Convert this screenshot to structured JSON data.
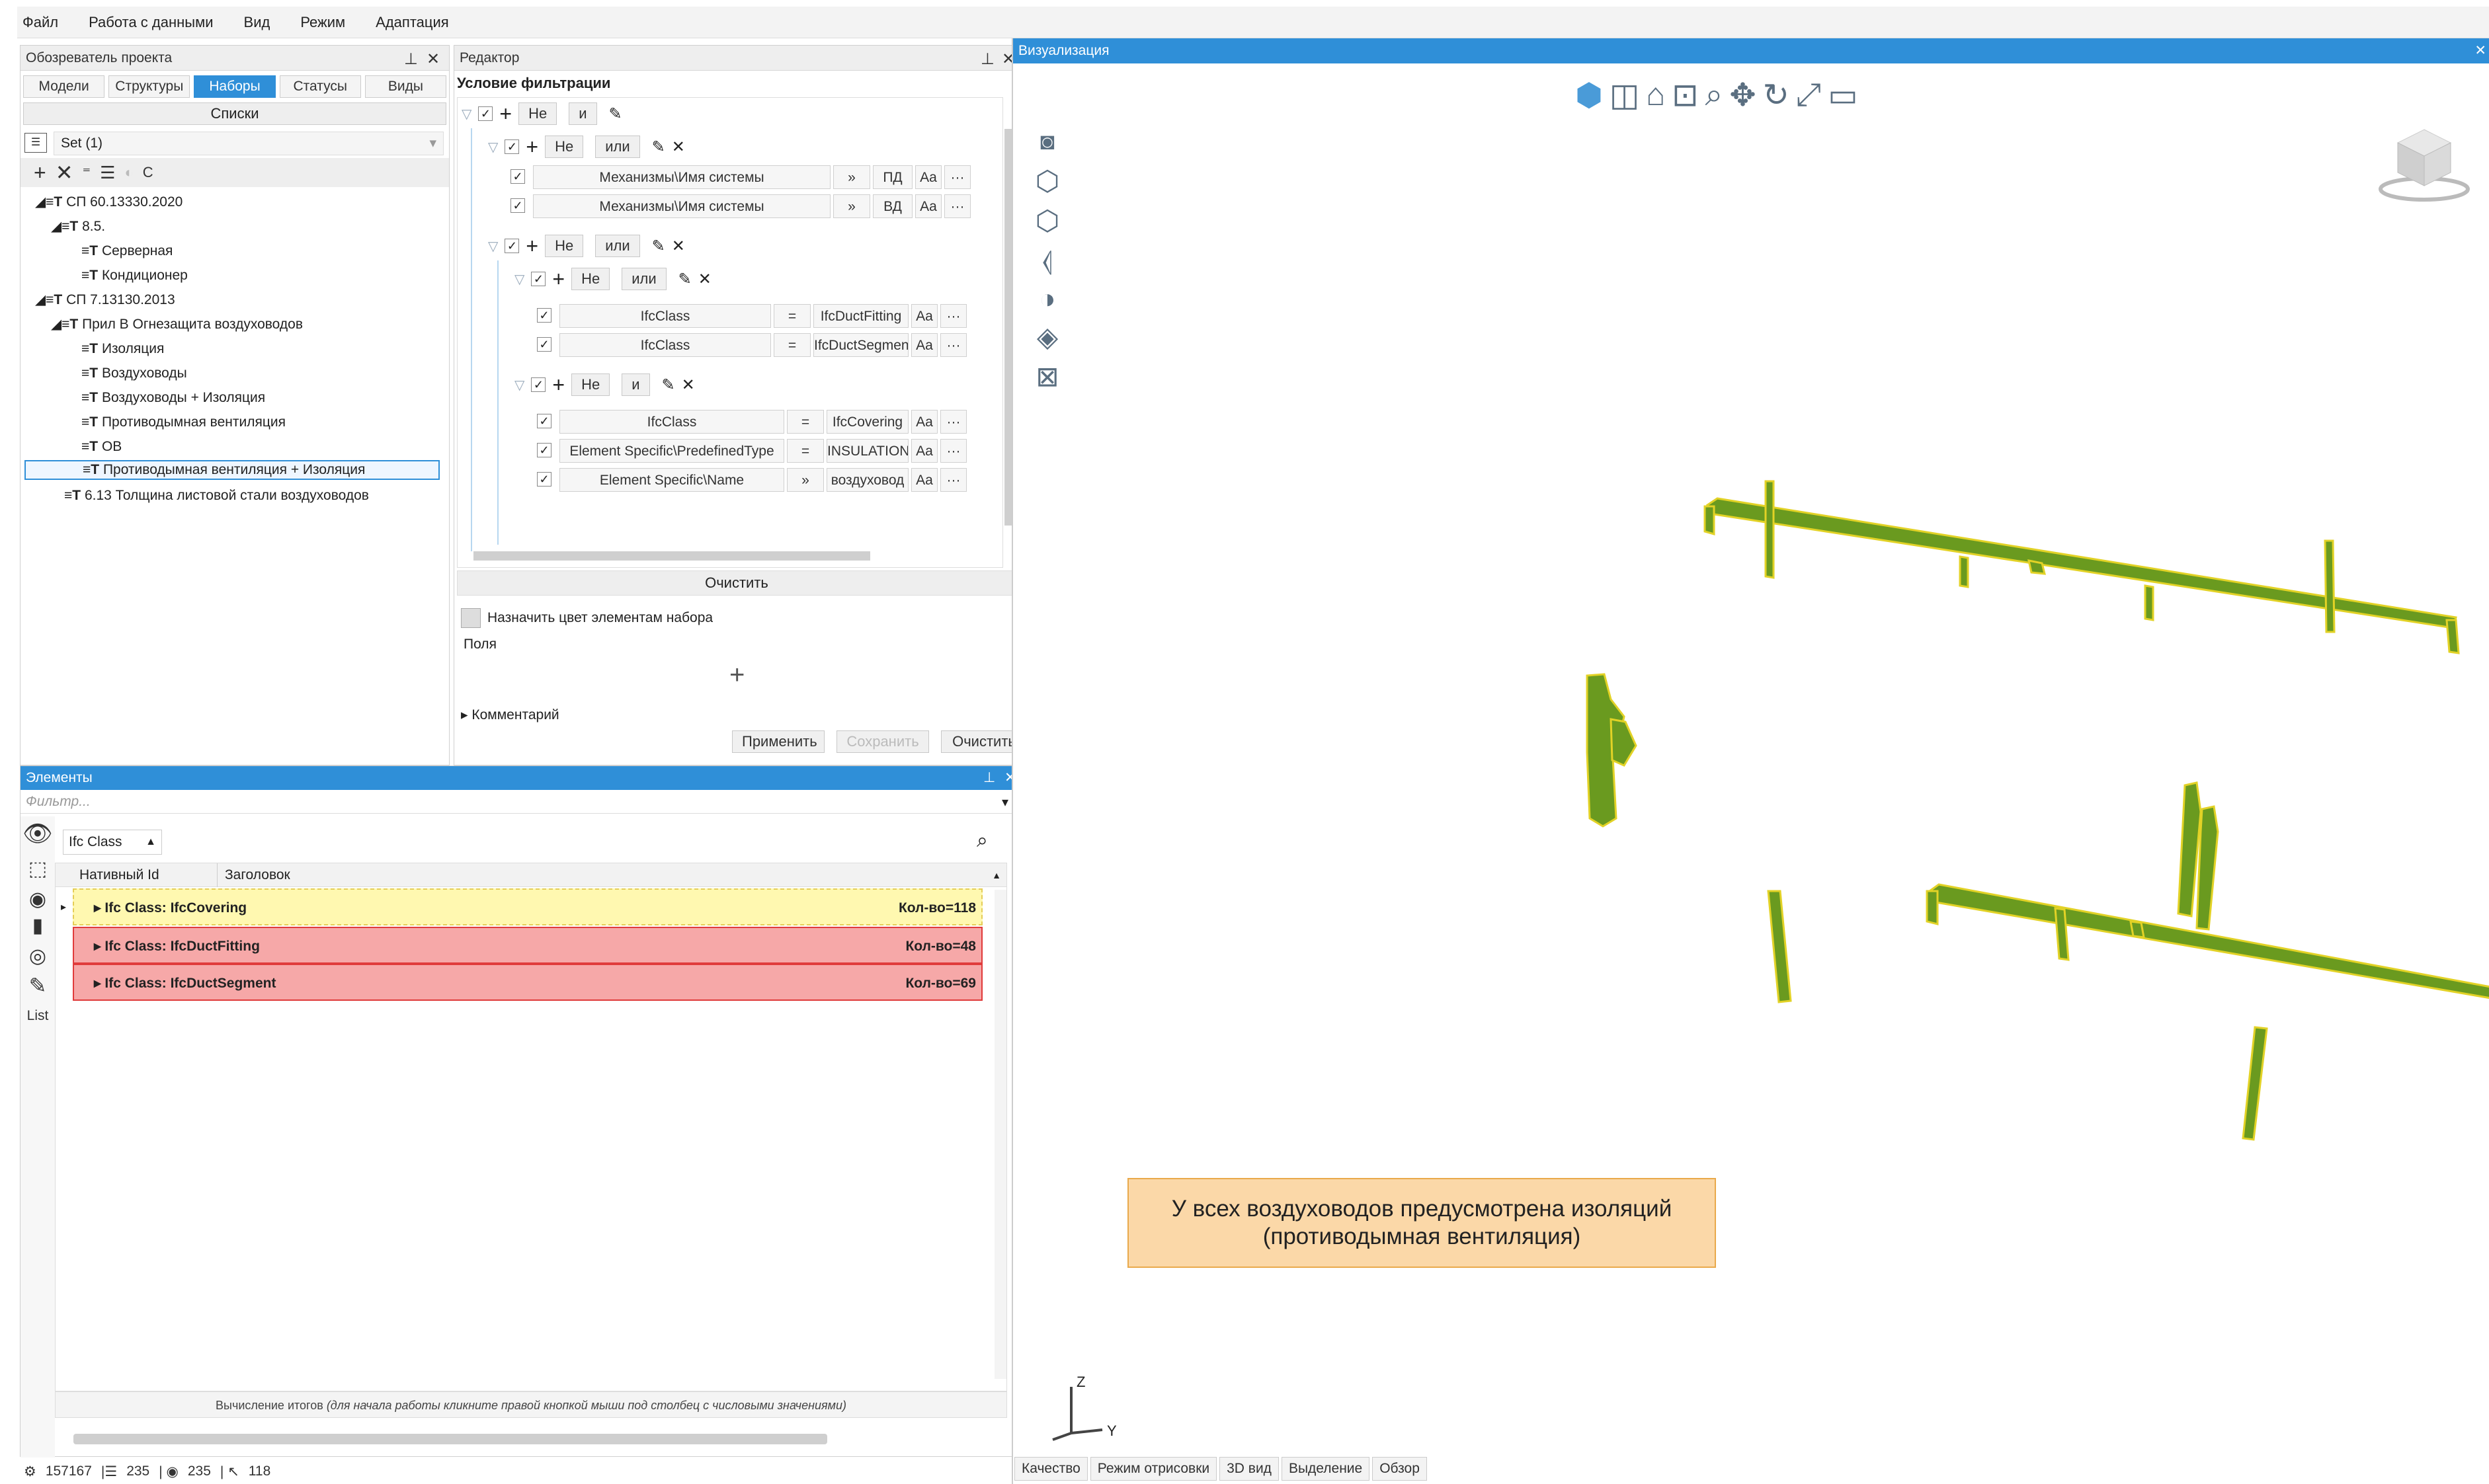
{
  "menu": [
    "Файл",
    "Работа с данными",
    "Вид",
    "Режим",
    "Адаптация"
  ],
  "explorer": {
    "title": "Обозреватель проекта",
    "tabs": [
      "Модели",
      "Структуры",
      "Наборы",
      "Статусы",
      "Виды"
    ],
    "active_tab": "Наборы",
    "lists_label": "Списки",
    "set_selector": "Set (1)",
    "tree": [
      "СП 60.13330.2020",
      "8.5.",
      "Серверная",
      "Кондиционер",
      "СП 7.13130.2013",
      "Прил В Огнезащита воздуховодов",
      "Изоляция",
      "Воздуховоды",
      "Воздуховоды + Изоляция",
      "Противодымная вентиляция",
      "ОВ",
      "Противодымная вентиляция + Изоляция",
      "6.13 Толщина листовой стали воздуховодов"
    ]
  },
  "editor": {
    "title": "Редактор",
    "condition_title": "Условие фильтрации",
    "op_not": "Не",
    "op_and": "и",
    "op_or": "или",
    "rows": [
      {
        "field": "Механизмы\\Имя системы",
        "op": "»",
        "value": "ПД",
        "case": "Aa",
        "more": "···"
      },
      {
        "field": "Механизмы\\Имя системы",
        "op": "»",
        "value": "ВД",
        "case": "Aa",
        "more": "···"
      },
      {
        "field": "IfcClass",
        "op": "=",
        "value": "IfcDuctFitting",
        "case": "Aa",
        "more": "···"
      },
      {
        "field": "IfcClass",
        "op": "=",
        "value": "IfcDuctSegment",
        "case": "Aa",
        "more": "···"
      },
      {
        "field": "IfcClass",
        "op": "=",
        "value": "IfcCovering",
        "case": "Aa",
        "more": "···"
      },
      {
        "field": "Element Specific\\PredefinedType",
        "op": "=",
        "value": "INSULATION",
        "case": "Aa",
        "more": "···"
      },
      {
        "field": "Element Specific\\Name",
        "op": "»",
        "value": "воздуховод",
        "case": "Aa",
        "more": "···"
      }
    ],
    "clear_label": "Очистить",
    "assign_color": "Назначить цвет элементам набора",
    "fields_label": "Поля",
    "comment_label": "Комментарий",
    "apply": "Применить",
    "save": "Сохранить",
    "clear2": "Очистить"
  },
  "elements": {
    "title": "Элементы",
    "filter_placeholder": "Фильтр...",
    "group_by": "Ifc Class",
    "col_id": "Нативный Id",
    "col_title": "Заголовок",
    "rows": [
      {
        "label": "Ifc Class: IfcCovering",
        "count": "Кол-во=118"
      },
      {
        "label": "Ifc Class: IfcDuctFitting",
        "count": "Кол-во=48"
      },
      {
        "label": "Ifc Class: IfcDuctSegment",
        "count": "Кол-во=69"
      }
    ],
    "list_label": "List",
    "footer_bold": "Вычисление итогов",
    "footer_italic": "(для начала работы кликните правой кнопкой мыши под столбец с числовыми значениями)"
  },
  "status": {
    "models": "157167",
    "items": "235",
    "visible": "235",
    "selected": "118"
  },
  "viz": {
    "title": "Визуализация",
    "note": "У всех воздуховодов предусмотрена изоляций (противодымная вентиляция)",
    "axis_z": "Z",
    "axis_y": "Y",
    "bottom_tabs": [
      "Качество",
      "Режим отрисовки",
      "3D вид",
      "Выделение",
      "Обзор"
    ],
    "colors": {
      "duct": "#6a9a1f",
      "edge": "#e2d226",
      "titlebar": "#2f8fd8"
    }
  }
}
